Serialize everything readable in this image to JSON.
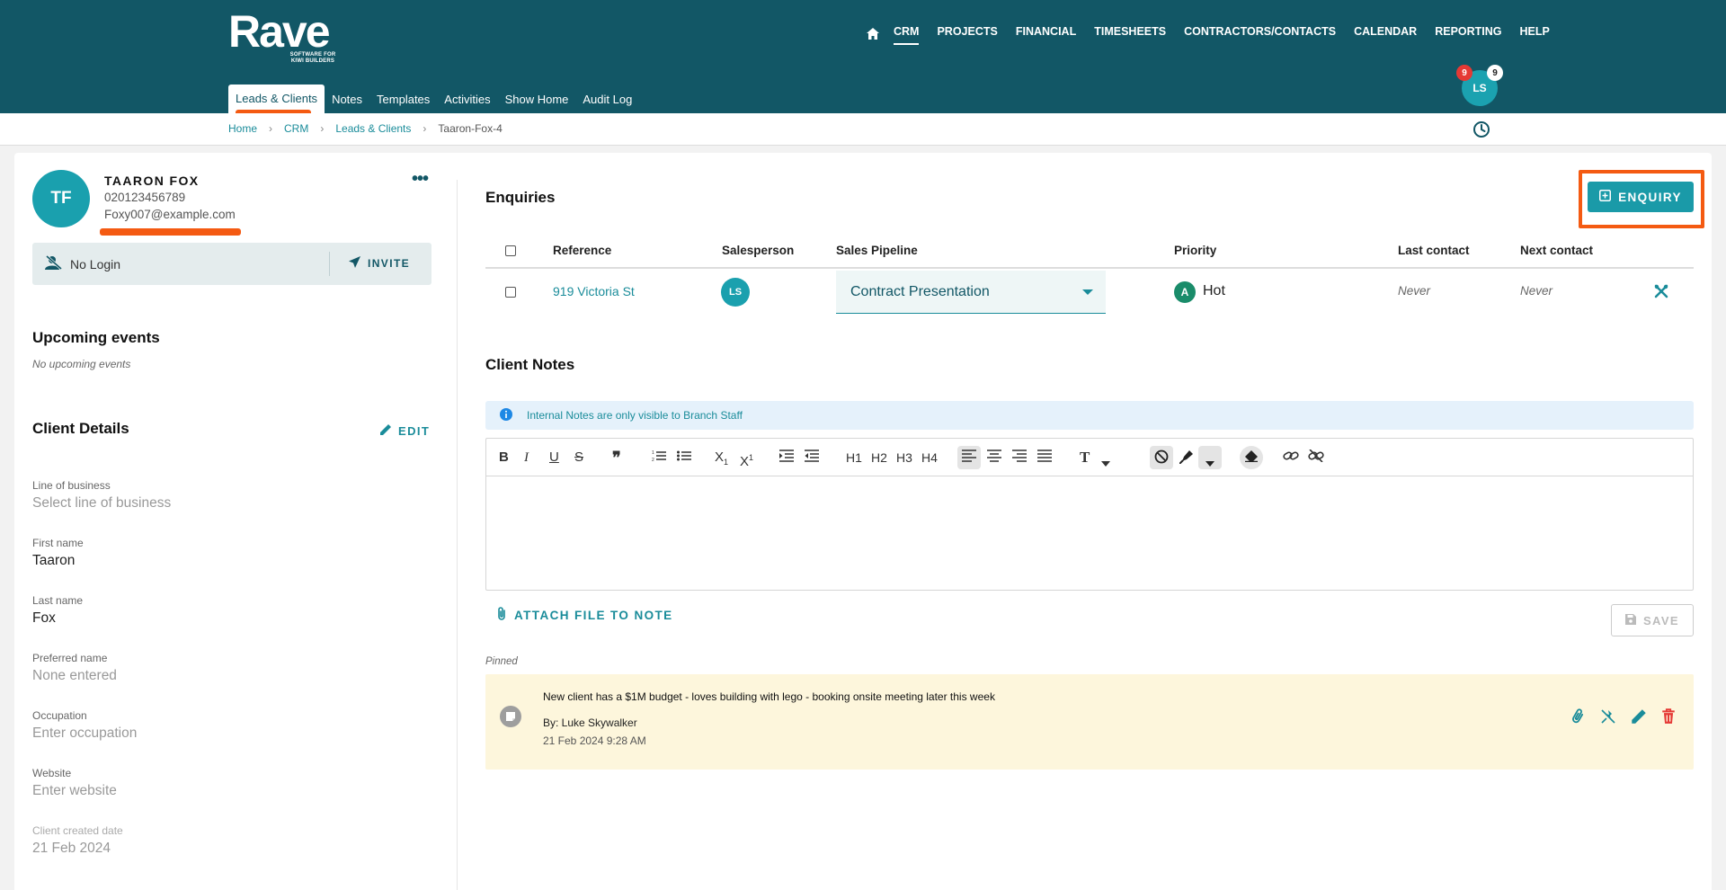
{
  "brand": {
    "logo_word": "Rave",
    "logo_tagline": "SOFTWARE FOR KIWI BUILDERS"
  },
  "main_nav": [
    "CRM",
    "PROJECTS",
    "FINANCIAL",
    "TIMESHEETS",
    "CONTRACTORS/CONTACTS",
    "CALENDAR",
    "REPORTING",
    "HELP"
  ],
  "main_nav_active": "CRM",
  "sub_nav": [
    "Leads & Clients",
    "Notes",
    "Templates",
    "Activities",
    "Show Home",
    "Audit Log"
  ],
  "sub_nav_active": "Leads & Clients",
  "user": {
    "initials": "LS",
    "badge_red": "9",
    "badge_white": "9"
  },
  "breadcrumb": [
    "Home",
    "CRM",
    "Leads & Clients",
    "Taaron-Fox-4"
  ],
  "client": {
    "initials": "TF",
    "name": "TAARON FOX",
    "phone": "020123456789",
    "email": "Foxy007@example.com",
    "login_status": "No Login",
    "invite_label": "INVITE"
  },
  "upcoming": {
    "heading": "Upcoming events",
    "empty_text": "No upcoming events"
  },
  "client_details": {
    "heading": "Client Details",
    "edit_label": "EDIT",
    "fields": [
      {
        "label": "Line of business",
        "value": "Select line of business",
        "empty": true
      },
      {
        "label": "First name",
        "value": "Taaron",
        "empty": false
      },
      {
        "label": "Last name",
        "value": "Fox",
        "empty": false
      },
      {
        "label": "Preferred name",
        "value": "None entered",
        "empty": true
      },
      {
        "label": "Occupation",
        "value": "Enter occupation",
        "empty": true
      },
      {
        "label": "Website",
        "value": "Enter website",
        "empty": true
      },
      {
        "label": "Client created date",
        "value": "21 Feb 2024",
        "empty": true
      }
    ]
  },
  "enquiries": {
    "heading": "Enquiries",
    "add_button": "ENQUIRY",
    "columns": [
      "Reference",
      "Salesperson",
      "Sales Pipeline",
      "Priority",
      "Last contact",
      "Next contact"
    ],
    "rows": [
      {
        "reference": "919 Victoria St",
        "salesperson_initials": "LS",
        "pipeline": "Contract Presentation",
        "priority_badge": "A",
        "priority": "Hot",
        "last_contact": "Never",
        "next_contact": "Never"
      }
    ]
  },
  "client_notes": {
    "heading": "Client Notes",
    "info_text": "Internal Notes are only visible to Branch Staff",
    "attach_label": "ATTACH FILE TO NOTE",
    "save_label": "SAVE",
    "pinned_label": "Pinned",
    "pinned_note": {
      "text": "New client has a $1M budget - loves building with lego - booking onsite meeting later this week",
      "by": "By: Luke Skywalker",
      "date": "21 Feb 2024 9:28 AM"
    }
  },
  "colors": {
    "header_bg": "#125766",
    "accent": "#1a9aa8",
    "annotation": "#f45a12",
    "note_bg": "#fdf6dc"
  }
}
